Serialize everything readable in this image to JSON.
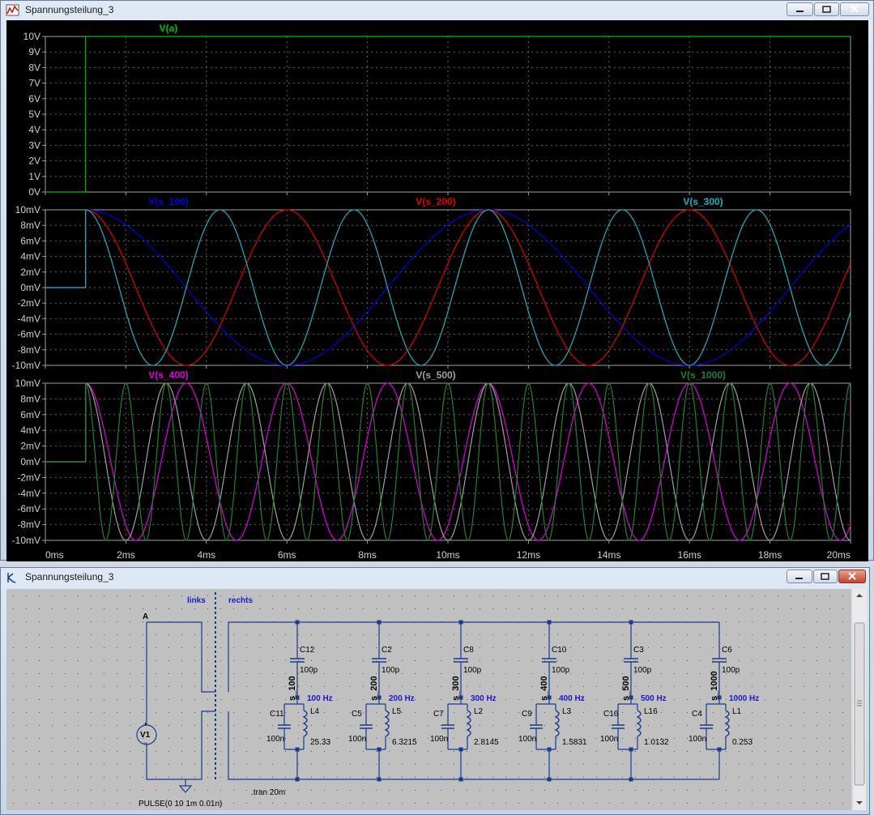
{
  "plot_window": {
    "title": "Spannungsteilung_3",
    "chart_data": [
      {
        "type": "line",
        "pane": "top",
        "series": [
          {
            "name": "V(a)",
            "color": "#00c000",
            "x": [
              0,
              1,
              1,
              20
            ],
            "y": [
              0,
              0,
              10,
              10
            ]
          }
        ],
        "yticks": [
          "10V",
          "9V",
          "8V",
          "7V",
          "6V",
          "5V",
          "4V",
          "3V",
          "2V",
          "1V",
          "0V"
        ],
        "ylim": [
          0,
          10
        ],
        "xlim": [
          0,
          20
        ]
      },
      {
        "type": "line",
        "pane": "middle",
        "series": [
          {
            "name": "V(s_100)",
            "color": "#0000e0",
            "freq_hz": 100
          },
          {
            "name": "V(s_200)",
            "color": "#e00000",
            "freq_hz": 200
          },
          {
            "name": "V(s_300)",
            "color": "#20b0c0",
            "freq_hz": 300
          }
        ],
        "yticks": [
          "10mV",
          "8mV",
          "6mV",
          "4mV",
          "2mV",
          "0mV",
          "-2mV",
          "-4mV",
          "-6mV",
          "-8mV",
          "-10mV"
        ],
        "ylim": [
          -10,
          10
        ],
        "xlim": [
          0,
          20
        ]
      },
      {
        "type": "line",
        "pane": "bottom",
        "series": [
          {
            "name": "V(s_400)",
            "color": "#e000e0",
            "freq_hz": 400
          },
          {
            "name": "V(s_500)",
            "color": "#a0a0a0",
            "freq_hz": 500
          },
          {
            "name": "V(s_1000)",
            "color": "#208030",
            "freq_hz": 1000
          }
        ],
        "yticks": [
          "10mV",
          "8mV",
          "6mV",
          "4mV",
          "2mV",
          "0mV",
          "-2mV",
          "-4mV",
          "-6mV",
          "-8mV",
          "-10mV"
        ],
        "ylim": [
          -10,
          10
        ],
        "xlim": [
          0,
          20
        ]
      }
    ],
    "xticks": [
      "0ms",
      "2ms",
      "4ms",
      "6ms",
      "8ms",
      "10ms",
      "12ms",
      "14ms",
      "16ms",
      "18ms",
      "20ms"
    ],
    "step_time_ms": 1
  },
  "schematic_window": {
    "title": "Spannungsteilung_3",
    "labels": {
      "links": "links",
      "rechts": "rechts",
      "node_a": "A",
      "source": "V1",
      "pulse": "PULSE(0 10 1m 0.01n)",
      "tran": ".tran 20m"
    },
    "branches": [
      {
        "cser": "C12",
        "cser_val": "100p",
        "node": "s_100",
        "freq": "100 Hz",
        "cpar": "C11",
        "cpar_val": "100n",
        "ind": "L4",
        "ind_val": "25.33"
      },
      {
        "cser": "C2",
        "cser_val": "100p",
        "node": "s_200",
        "freq": "200 Hz",
        "cpar": "C5",
        "cpar_val": "100n",
        "ind": "L5",
        "ind_val": "6.3215"
      },
      {
        "cser": "C8",
        "cser_val": "100p",
        "node": "s_300",
        "freq": "300 Hz",
        "cpar": "C7",
        "cpar_val": "100n",
        "ind": "L2",
        "ind_val": "2.8145"
      },
      {
        "cser": "C10",
        "cser_val": "100p",
        "node": "s_400",
        "freq": "400 Hz",
        "cpar": "C9",
        "cpar_val": "100n",
        "ind": "L3",
        "ind_val": "1.5831"
      },
      {
        "cser": "C3",
        "cser_val": "100p",
        "node": "s_500",
        "freq": "500 Hz",
        "cpar": "C16",
        "cpar_val": "100n",
        "ind": "L16",
        "ind_val": "1.0132"
      },
      {
        "cser": "C6",
        "cser_val": "100p",
        "node": "s_1000",
        "freq": "1000 Hz",
        "cpar": "C4",
        "cpar_val": "100n",
        "ind": "L1",
        "ind_val": "0.253"
      }
    ]
  }
}
